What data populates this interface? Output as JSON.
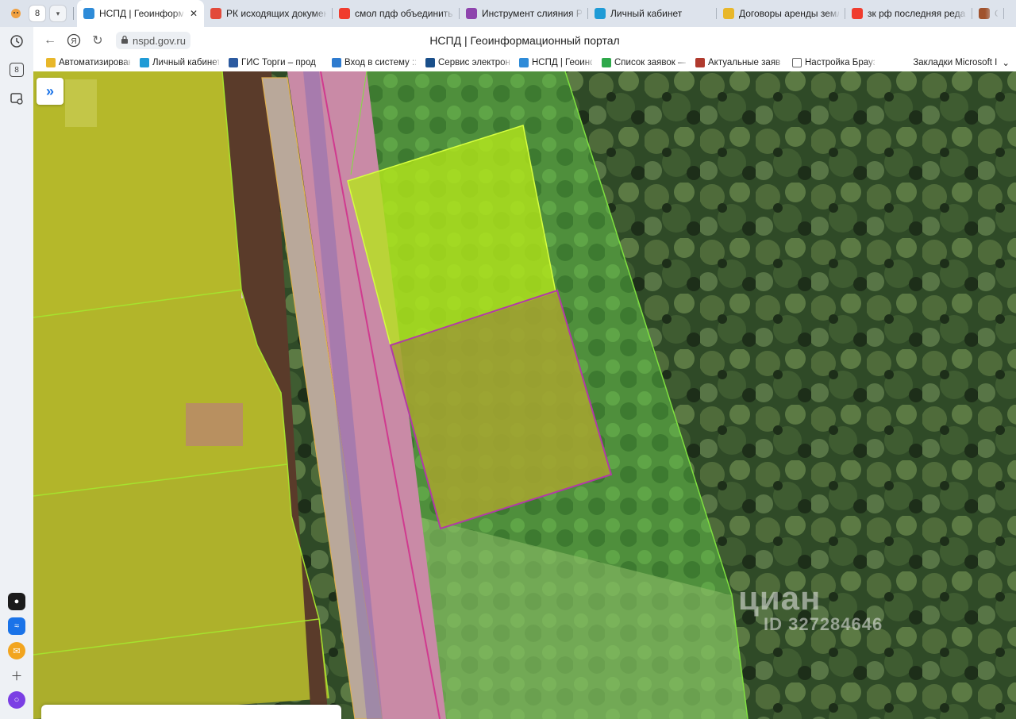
{
  "browser": {
    "tab_count": "8",
    "tabs": [
      {
        "title": "НСПД | Геоинформа",
        "favicon_color": "#2e8bd8",
        "active": true
      },
      {
        "title": "РК исходящих докумен",
        "favicon_color": "#e24a3b",
        "active": false
      },
      {
        "title": "смол пдф объединить г",
        "favicon_color": "#f03c2e",
        "active": false
      },
      {
        "title": "Инструмент слияния PD",
        "favicon_color": "#8e44ad",
        "active": false
      },
      {
        "title": "Личный кабинет",
        "favicon_color": "#1f9bd6",
        "active": false
      },
      {
        "title": "Договоры аренды земл",
        "favicon_color": "#e8b72a",
        "active": false
      },
      {
        "title": "зк рф последняя редак",
        "favicon_color": "#f03c2e",
        "active": false
      },
      {
        "title": "С",
        "favicon_color": "#a0522d",
        "active": false
      }
    ],
    "close_glyph": "✕",
    "url": "nspd.gov.ru",
    "page_title": "НСПД | Геоинформационный портал",
    "bookmarks": [
      {
        "label": "Автоматизирован",
        "icon_color": "#e8b72a"
      },
      {
        "label": "Личный кабинет",
        "icon_color": "#1f9bd6"
      },
      {
        "label": "ГИС Торги – прод",
        "icon_color": "#2c5aa0"
      },
      {
        "label": "Вход в систему :: \\",
        "icon_color": "#2e7bcf"
      },
      {
        "label": "Сервис электронн",
        "icon_color": "#1a4f8a"
      },
      {
        "label": "НСПД | Геоинфор",
        "icon_color": "#2e8bd8"
      },
      {
        "label": "Список заявок —",
        "icon_color": "#2ea84a"
      },
      {
        "label": "Актуальные заяв",
        "icon_color": "#b03a2e"
      },
      {
        "label": "Настройка Брауз",
        "icon_color": "#ffffff"
      }
    ],
    "bookmarks_more_label": "Закладки Microsoft I",
    "sidebar_tab_count": "8"
  },
  "map": {
    "expand_glyph": "»",
    "watermark": {
      "brand": "циан",
      "id_text": "ID 327284646"
    },
    "colors": {
      "parcel_yellow": "#c8d21e",
      "parcel_lime": "#b6f01a",
      "parcel_outline_green": "#7fe040",
      "parcel_outline_magenta": "#b23aa6",
      "road_pink": "#e58bb5",
      "road_line": "#d03a8f"
    }
  }
}
